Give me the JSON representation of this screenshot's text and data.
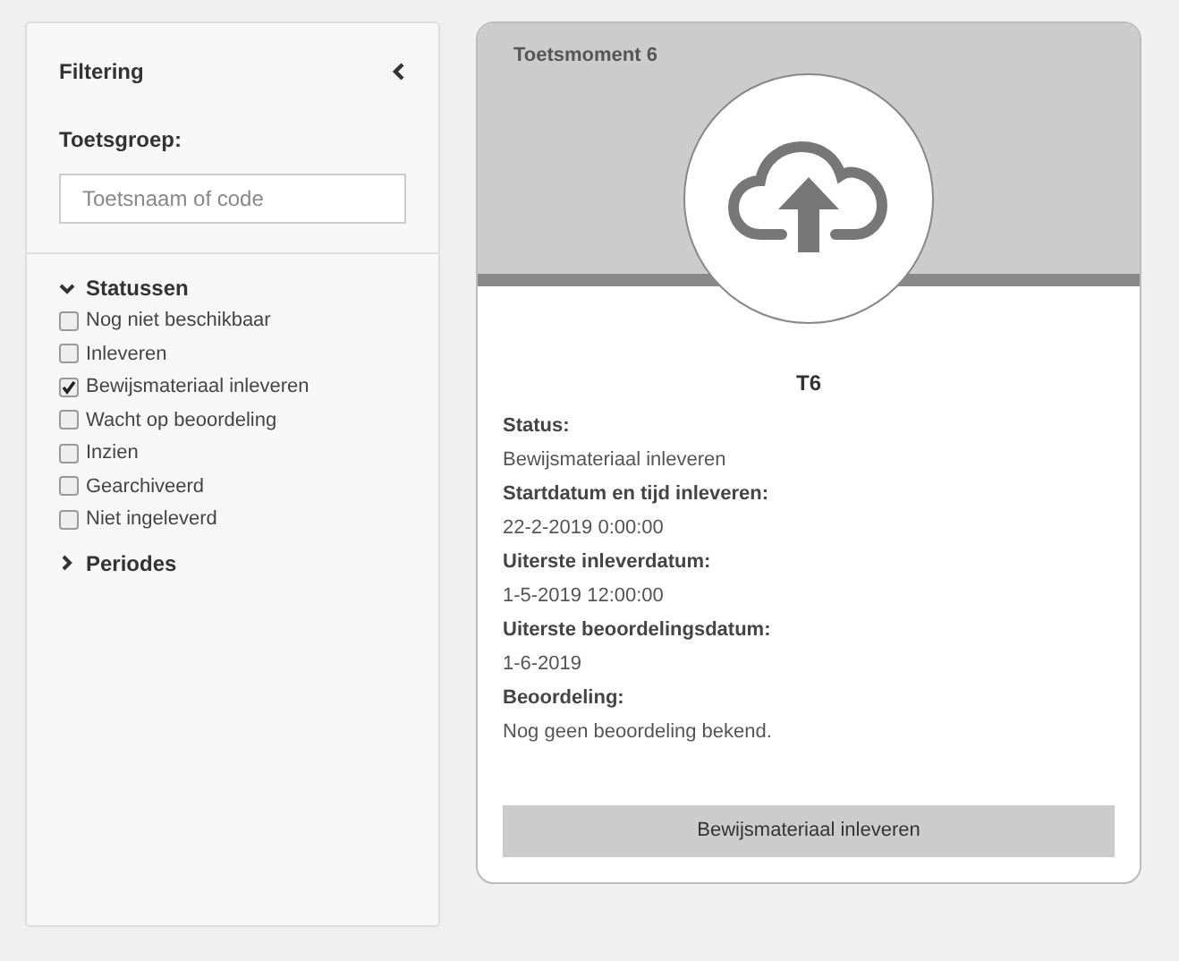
{
  "filter": {
    "title": "Filtering",
    "group_label": "Toetsgroep:",
    "search": {
      "placeholder": "Toetsnaam of code"
    },
    "sections": [
      {
        "title": "Statussen",
        "expanded": true,
        "items": [
          {
            "label": "Nog niet beschikbaar",
            "checked": false
          },
          {
            "label": "Inleveren",
            "checked": false
          },
          {
            "label": "Bewijsmateriaal inleveren",
            "checked": true
          },
          {
            "label": "Wacht op beoordeling",
            "checked": false
          },
          {
            "label": "Inzien",
            "checked": false
          },
          {
            "label": "Gearchiveerd",
            "checked": false
          },
          {
            "label": "Niet ingeleverd",
            "checked": false
          }
        ]
      },
      {
        "title": "Periodes",
        "expanded": false
      }
    ]
  },
  "card": {
    "title": "Toetsmoment 6",
    "code": "T6",
    "fields": [
      {
        "label": "Status:",
        "value": "Bewijsmateriaal inleveren"
      },
      {
        "label": "Startdatum en tijd inleveren:",
        "value": "22-2-2019 0:00:00"
      },
      {
        "label": "Uiterste inleverdatum:",
        "value": "1-5-2019 12:00:00"
      },
      {
        "label": "Uiterste beoordelingsdatum:",
        "value": "1-6-2019"
      },
      {
        "label": "Beoordeling:",
        "value": "Nog geen beoordeling bekend."
      }
    ],
    "button": "Bewijsmateriaal inleveren"
  }
}
